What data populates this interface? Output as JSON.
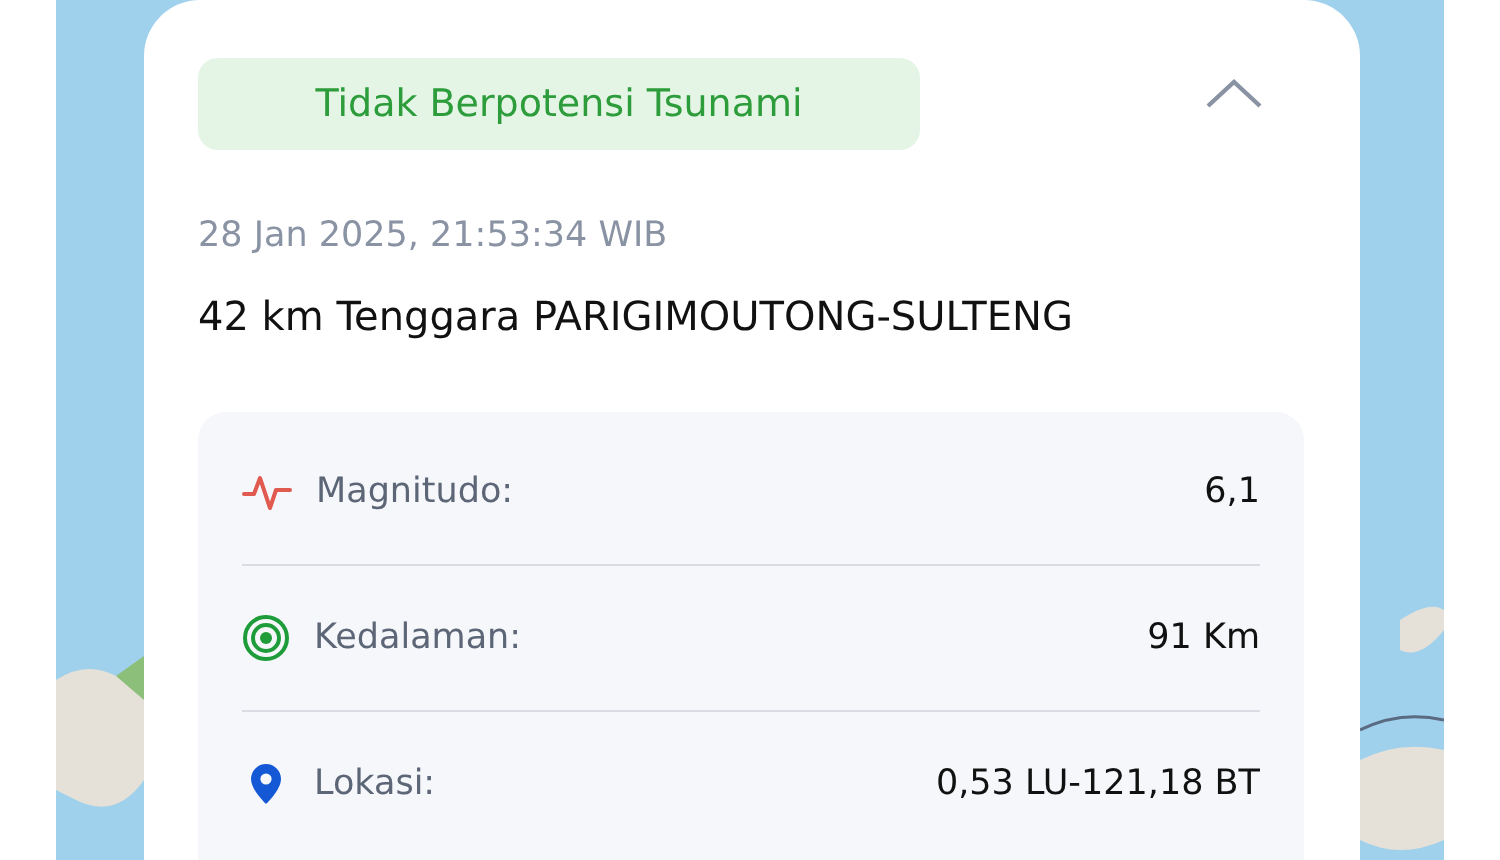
{
  "card": {
    "expanded": true,
    "badge": "Tidak Berpotensi Tsunami",
    "datetime": "28 Jan 2025, 21:53:34 WIB",
    "location_title": "42 km Tenggara PARIGIMOUTONG-SULTENG",
    "details": [
      {
        "kind": "magnitude",
        "label": "Magnitudo:",
        "value": "6,1"
      },
      {
        "kind": "depth",
        "label": "Kedalaman:",
        "value": "91 Km"
      },
      {
        "kind": "location",
        "label": "Lokasi:",
        "value": "0,53 LU-121,18 BT"
      }
    ]
  }
}
